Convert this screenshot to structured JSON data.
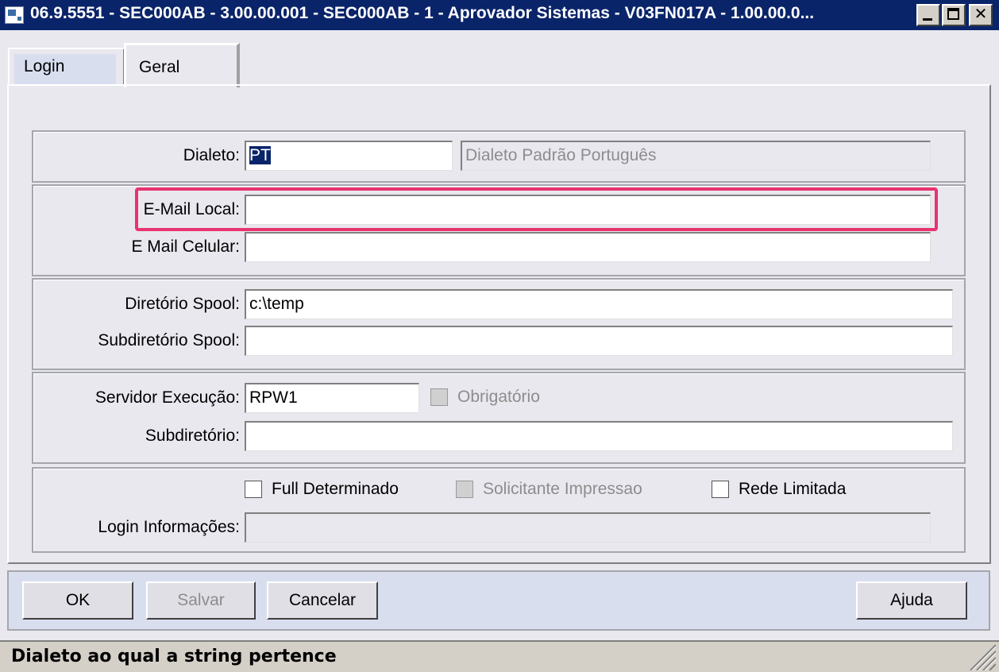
{
  "window": {
    "title": "06.9.5551 - SEC000AB - 3.00.00.001 - SEC000AB - 1 - Aprovador Sistemas - V03FN017A - 1.00.00.0..."
  },
  "tabs": [
    {
      "label": "Login"
    },
    {
      "label": "Geral"
    }
  ],
  "dialeto": {
    "label": "Dialeto:",
    "value": "PT",
    "description": "Dialeto Padrão Português"
  },
  "email": {
    "local_label": "E-Mail Local:",
    "local_value": "",
    "celular_label": "E Mail Celular:",
    "celular_value": ""
  },
  "spool": {
    "dir_label": "Diretório Spool:",
    "dir_value": "c:\\temp",
    "subdir_label": "Subdiretório Spool:",
    "subdir_value": ""
  },
  "execucao": {
    "servidor_label": "Servidor Execução:",
    "servidor_value": "RPW1",
    "obrigatorio_label": "Obrigatório",
    "subdir_label": "Subdiretório:",
    "subdir_value": ""
  },
  "options": {
    "full_label": "Full Determinado",
    "solicitante_label": "Solicitante Impressao",
    "rede_label": "Rede Limitada",
    "login_info_label": "Login Informações:",
    "login_info_value": ""
  },
  "buttons": {
    "ok": "OK",
    "salvar": "Salvar",
    "cancelar": "Cancelar",
    "ajuda": "Ajuda"
  },
  "status": {
    "text": "Dialeto ao qual a string pertence"
  },
  "colors": {
    "titlebar": "#0a246a",
    "highlight": "#e8336e"
  }
}
